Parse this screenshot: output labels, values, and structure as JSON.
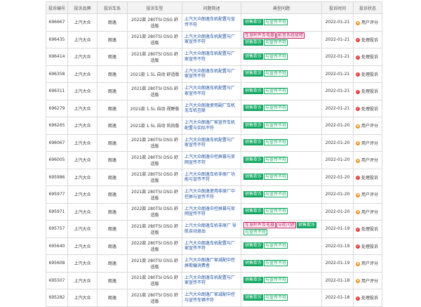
{
  "table": {
    "headers": [
      "投诉编号",
      "投诉品牌",
      "投诉车系",
      "投诉车型",
      "问题简述",
      "典型问题",
      "投诉时间",
      "投诉状态"
    ],
    "rows": [
      {
        "id": "696667",
        "brand": "上汽大众",
        "series": "朗逸",
        "model": "2022款 280TSI DSG 舒适版",
        "desc": "上汽大众朗逸车机配置与宣传不符",
        "tags": [
          {
            "text": "销售欺诈",
            "style": "green"
          },
          {
            "text": "与宣传不符",
            "style": "outline"
          }
        ],
        "date": "2022-01-21",
        "status": "用户评分",
        "status_kind": "eval"
      },
      {
        "id": "696435",
        "brand": "上汽大众",
        "series": "朗逸",
        "model": "2021款 280TSI DSG 舒适版",
        "desc": "上汽大众朗逸车机配置与厂家宣传不符",
        "tags": [
          {
            "text": "车身附件及电器",
            "style": "pink"
          },
          {
            "text": "影音系统故障",
            "style": "pink"
          },
          {
            "text": "销售欺诈",
            "style": "green"
          },
          {
            "text": "与宣传不符",
            "style": "outline"
          }
        ],
        "date": "2022-01-21",
        "status": "处理投诉",
        "status_kind": "done"
      },
      {
        "id": "696414",
        "brand": "上汽大众",
        "series": "朗逸",
        "model": "2021款 280TSI DSG 舒适版",
        "desc": "上汽大众朗逸车机配置与厂家宣传不符",
        "tags": [
          {
            "text": "销售欺诈",
            "style": "green"
          },
          {
            "text": "与宣传不符",
            "style": "outline"
          }
        ],
        "date": "2022-01-21",
        "status": "处理投诉",
        "status_kind": "done"
      },
      {
        "id": "696358",
        "brand": "上汽大众",
        "series": "朗逸",
        "model": "2021款 1.5L 自动 舒适版",
        "desc": "上汽大众朗逸车机配置与厂家宣传不符",
        "tags": [
          {
            "text": "销售欺诈",
            "style": "green"
          },
          {
            "text": "与宣传不符",
            "style": "outline"
          }
        ],
        "date": "2022-01-21",
        "status": "处理投诉",
        "status_kind": "done"
      },
      {
        "id": "696311",
        "brand": "上汽大众",
        "series": "朗逸",
        "model": "2021款 280TSI DSG 舒适版",
        "desc": "上汽大众朗逸车机配置与厂家宣传不符",
        "tags": [
          {
            "text": "销售欺诈",
            "style": "green"
          },
          {
            "text": "与宣传不符",
            "style": "outline"
          }
        ],
        "date": "2022-01-21",
        "status": "处理投诉",
        "status_kind": "done"
      },
      {
        "id": "696279",
        "brand": "上汽大众",
        "series": "朗逸",
        "model": "2021款 1.5L 自动 视野版",
        "desc": "上汽大众朗逸使用副厂车机无车机互联",
        "tags": [
          {
            "text": "销售欺诈",
            "style": "green"
          },
          {
            "text": "与宣传不符",
            "style": "outline"
          }
        ],
        "date": "2022-01-21",
        "status": "处理投诉",
        "status_kind": "done"
      },
      {
        "id": "696265",
        "brand": "上汽大众",
        "series": "朗逸",
        "model": "2021款 1.5L 自动 风尚版",
        "desc": "上汽大众朗逸厂家宣传车机配置与实际不符",
        "tags": [
          {
            "text": "销售欺诈",
            "style": "green"
          },
          {
            "text": "与宣传不符",
            "style": "outline"
          }
        ],
        "date": "2022-01-20",
        "status": "用户评分",
        "status_kind": "eval"
      },
      {
        "id": "696067",
        "brand": "上汽大众",
        "series": "朗逸",
        "model": "2021款 280TSI DSG 舒适版",
        "desc": "上汽大众朗逸车机配置与厂家宣传不符",
        "tags": [
          {
            "text": "销售欺诈",
            "style": "green"
          },
          {
            "text": "与宣传不符",
            "style": "outline"
          }
        ],
        "date": "2022-01-20",
        "status": "用户评分",
        "status_kind": "eval"
      },
      {
        "id": "696005",
        "brand": "上汽大众",
        "series": "朗逸",
        "model": "2021款 280TSI DSG 舒适版",
        "desc": "上汽大众朗逸中控屏幕与官网宣传不符",
        "tags": [
          {
            "text": "销售欺诈",
            "style": "green"
          },
          {
            "text": "与宣传不符",
            "style": "outline"
          }
        ],
        "date": "2022-01-20",
        "status": "用户评分",
        "status_kind": "eval"
      },
      {
        "id": "695986",
        "brand": "上汽大众",
        "series": "朗逸",
        "model": "2021款 280TSI DSG 舒适版",
        "desc": "上汽大众朗逸车机非原厂功能与宣传不符",
        "tags": [
          {
            "text": "销售欺诈",
            "style": "green"
          },
          {
            "text": "与宣传不符",
            "style": "outline"
          }
        ],
        "date": "2022-01-20",
        "status": "处理投诉",
        "status_kind": "done"
      },
      {
        "id": "695977",
        "brand": "上汽大众",
        "series": "朗逸",
        "model": "2021款 280TSI DSG 舒适版",
        "desc": "上汽大众朗逸使用非原厂中控屏与宣传不符",
        "tags": [
          {
            "text": "销售欺诈",
            "style": "green"
          },
          {
            "text": "与宣传不符",
            "style": "outline"
          }
        ],
        "date": "2022-01-20",
        "status": "用户评分",
        "status_kind": "eval"
      },
      {
        "id": "695971",
        "brand": "上汽大众",
        "series": "朗逸",
        "model": "2022款 280TSI DSG 舒适版",
        "desc": "上汽大众朗逸中控屏幕与官网宣传不符",
        "tags": [
          {
            "text": "销售欺诈",
            "style": "green"
          },
          {
            "text": "与宣传不符",
            "style": "outline"
          }
        ],
        "date": "2022-01-20",
        "status": "用户评分",
        "status_kind": "eval"
      },
      {
        "id": "695757",
        "brand": "上汽大众",
        "series": "朗逸",
        "model": "2021款 280TSI DSG 舒适版",
        "desc": "上汽大众朗逸车机非原厂 导航自动退出",
        "tags": [
          {
            "text": "车身附件及电器",
            "style": "pink"
          },
          {
            "text": "导航问题",
            "style": "pink"
          },
          {
            "text": "销售欺诈",
            "style": "green"
          },
          {
            "text": "与宣传不符",
            "style": "outline"
          }
        ],
        "date": "2022-01-19",
        "status": "处理投诉",
        "status_kind": "done"
      },
      {
        "id": "695640",
        "brand": "上汽大众",
        "series": "朗逸",
        "model": "2022款 280TSI DSG 舒适版",
        "desc": "上汽大众朗逸车机配置与厂家宣传不符",
        "tags": [
          {
            "text": "销售欺诈",
            "style": "green"
          },
          {
            "text": "与宣传不符",
            "style": "outline"
          }
        ],
        "date": "2022-01-19",
        "status": "处理投诉",
        "status_kind": "done"
      },
      {
        "id": "695608",
        "brand": "上汽大众",
        "series": "朗逸",
        "model": "2021款 280TSI DSG 舒适版",
        "desc": "上汽大众朗逸厂家减配中控屏欺骗消费者",
        "tags": [
          {
            "text": "销售欺诈",
            "style": "green"
          },
          {
            "text": "与宣传不符",
            "style": "outline"
          }
        ],
        "date": "2022-01-19",
        "status": "用户评分",
        "status_kind": "eval"
      },
      {
        "id": "695507",
        "brand": "上汽大众",
        "series": "朗逸",
        "model": "2021款 280TSI DSG 舒适版",
        "desc": "上汽大众朗逸车机配置与厂家宣传不符",
        "tags": [
          {
            "text": "销售欺诈",
            "style": "green"
          },
          {
            "text": "与宣传不符",
            "style": "outline"
          }
        ],
        "date": "2022-01-18",
        "status": "用户评分",
        "status_kind": "eval"
      },
      {
        "id": "695282",
        "brand": "上汽大众",
        "series": "朗逸",
        "model": "2021款 280TSI DSG 舒适版",
        "desc": "上汽大众朗逸厂家减配中控与宣传车辆不符",
        "tags": [
          {
            "text": "销售欺诈",
            "style": "green"
          },
          {
            "text": "与宣传不符",
            "style": "outline"
          }
        ],
        "date": "2022-01-18",
        "status": "处理投诉",
        "status_kind": "done"
      }
    ]
  }
}
